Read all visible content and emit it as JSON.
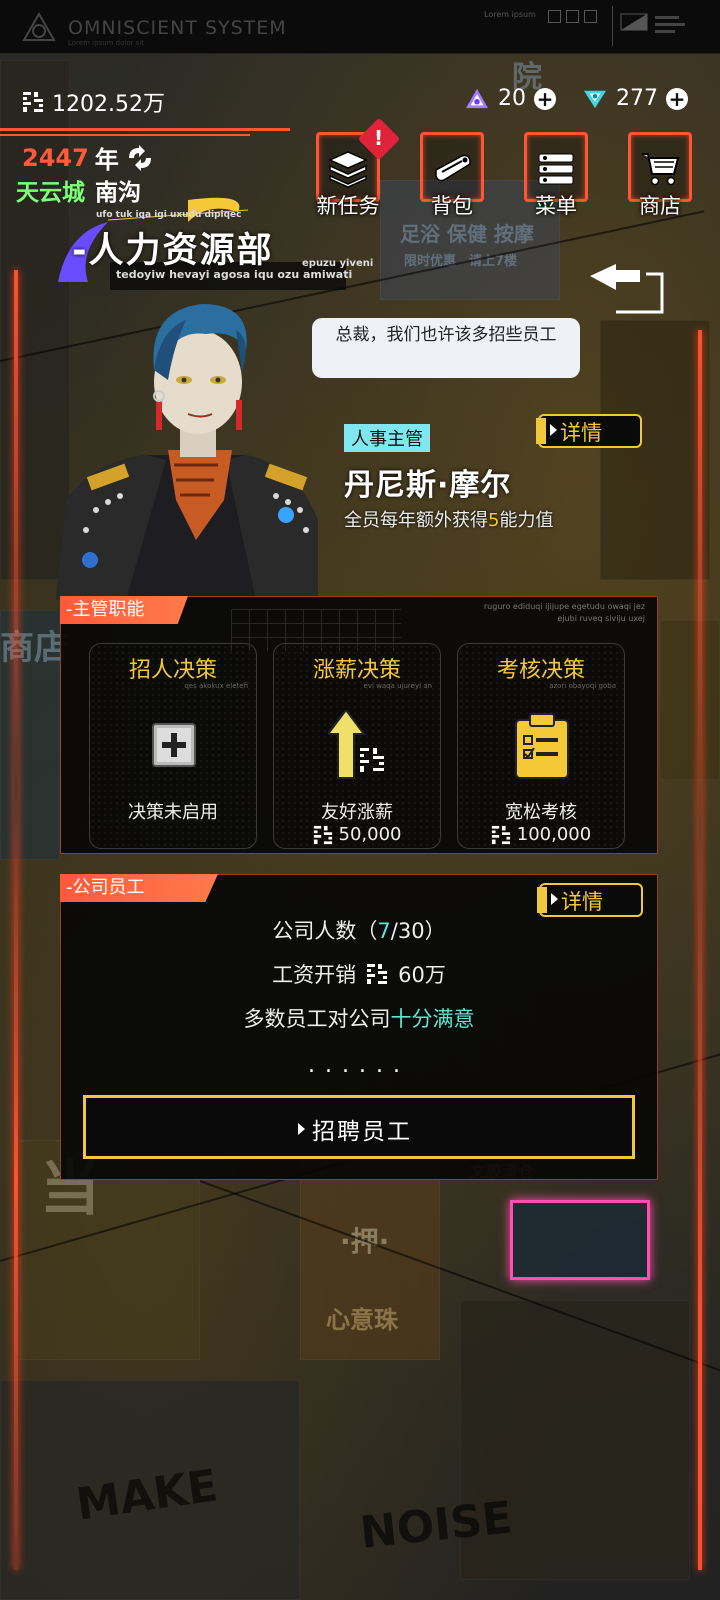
{
  "system": {
    "title": "OMNISCIENT SYSTEM",
    "subtitle": "Lorem ipsum dolor sit",
    "right_text": "Lorem ipsum"
  },
  "currency": {
    "money": "1202.52万",
    "gem_purple": "20",
    "gem_cyan": "277"
  },
  "date": {
    "year": "2447",
    "year_unit": "年"
  },
  "location": {
    "city": "天云城",
    "area": "南沟"
  },
  "nav": {
    "new_task": "新任务",
    "new_task_badge": "!",
    "backpack": "背包",
    "menu": "菜单",
    "shop": "商店"
  },
  "department": {
    "title": "人力资源部",
    "title_prefix": "-",
    "deco_top": "ufo tuk iqa igi uxudu dipiqec",
    "deco_right": "epuzu yiveni",
    "deco_bottom": "tedoyiw hevayi agosa iqu ozu amiwati"
  },
  "speech": {
    "text": "总裁，我们也许该多招些员工"
  },
  "supervisor": {
    "role": "人事主管",
    "name": "丹尼斯·摩尔",
    "bonus_prefix": "全员每年额外获得",
    "bonus_value": "5",
    "bonus_suffix": "能力值",
    "detail_label": "详情"
  },
  "duties": {
    "tab": "-主管职能",
    "deco_line1": "ruguro ediduqi ijijupe egetudu owaqi jez",
    "deco_line2": "ejubi ruveq siviju uxej",
    "cards": [
      {
        "title": "招人决策",
        "sub": "qes akokux eletefi",
        "status": "决策未启用",
        "cost": ""
      },
      {
        "title": "涨薪决策",
        "sub": "evi waqa ujureyi an",
        "status": "友好涨薪",
        "cost": "50,000"
      },
      {
        "title": "考核决策",
        "sub": "azori obayoqi goba",
        "status": "宽松考核",
        "cost": "100,000"
      }
    ]
  },
  "employees": {
    "tab": "-公司员工",
    "detail_label": "详情",
    "count_label": "公司人数（",
    "count_current": "7",
    "count_sep": "/30）",
    "salary_label": "工资开销",
    "salary_value": "60万",
    "mood_label": "多数员工对公司",
    "mood_value": "十分满意",
    "dots": "......",
    "recruit_label": "招聘员工"
  },
  "colors": {
    "accent_red": "#ff5533",
    "accent_gold": "#f5c838",
    "accent_green": "#7dff7a",
    "accent_cyan": "#58e8d4"
  }
}
